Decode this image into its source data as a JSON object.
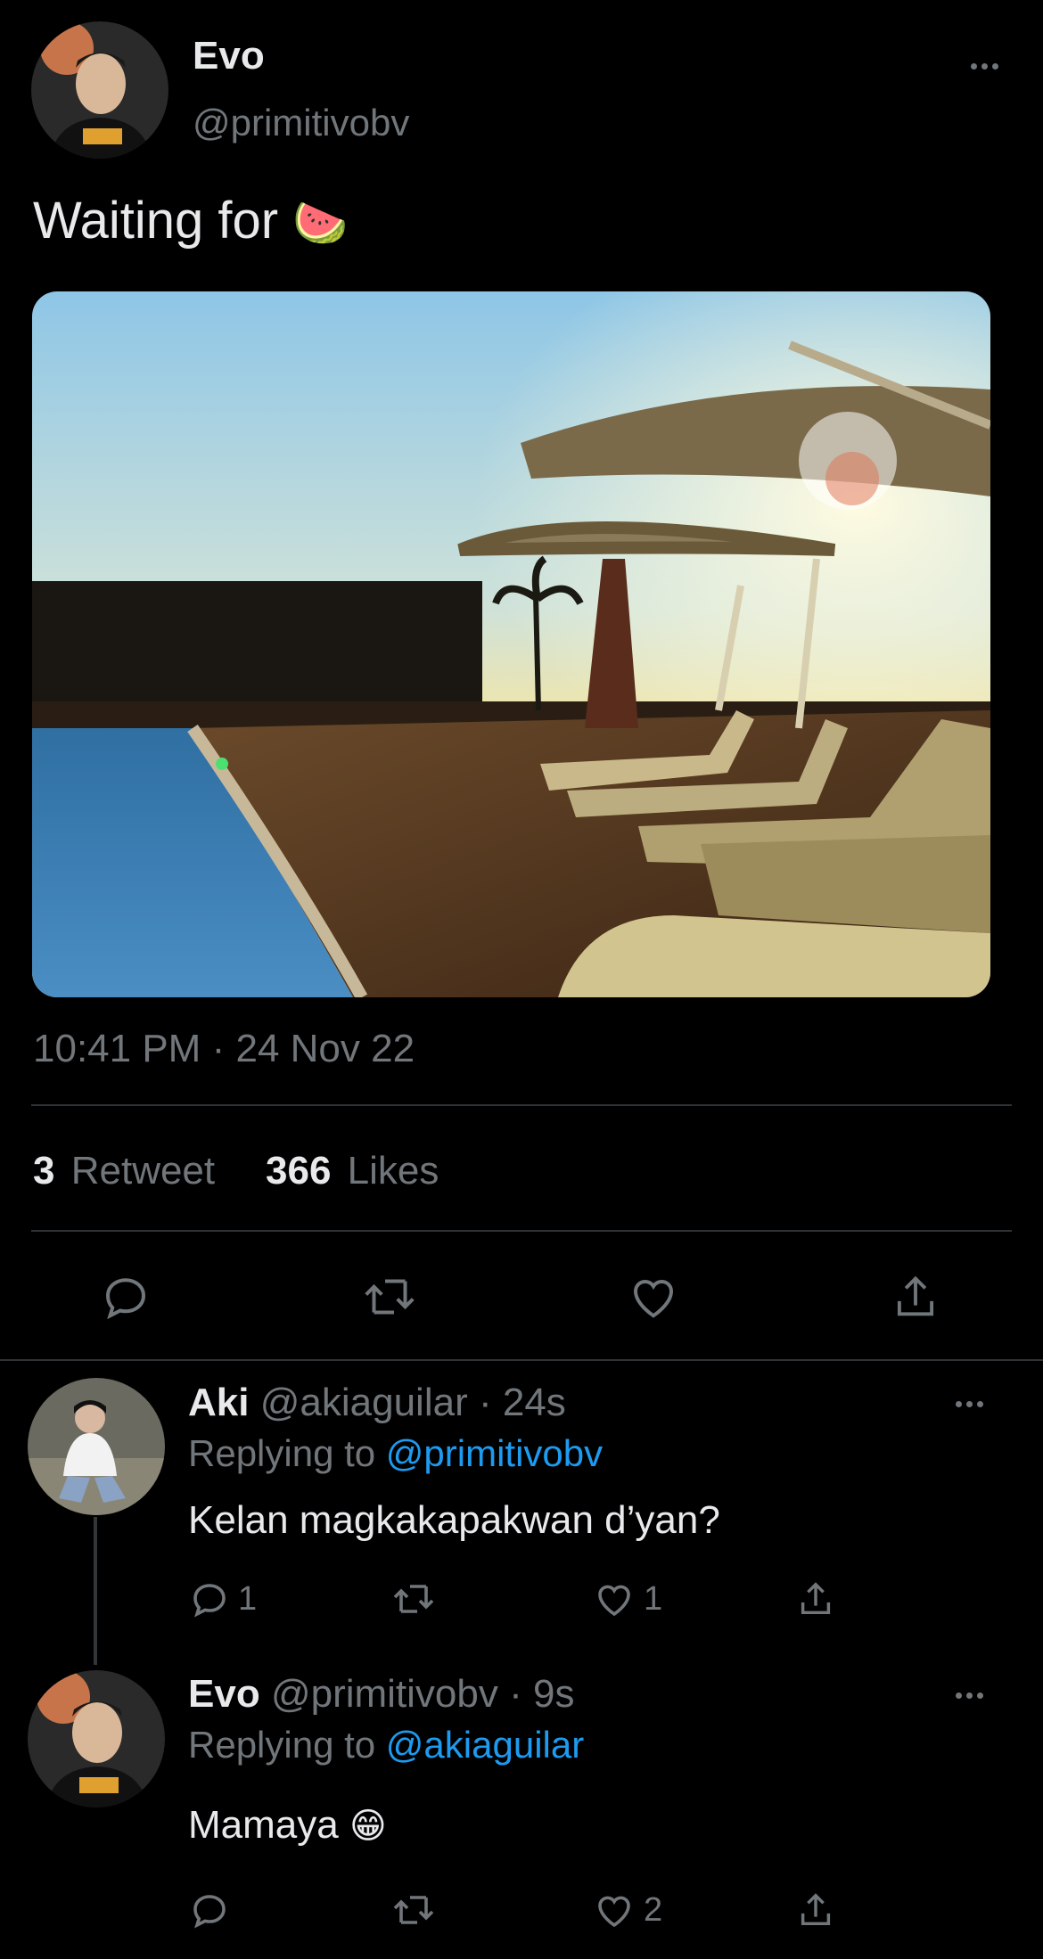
{
  "main_tweet": {
    "name": "Evo",
    "handle": "@primitivobv",
    "text": "Waiting for",
    "emoji": "🍉",
    "time": "10:41 PM",
    "date": "24 Nov 22",
    "retweets_count": "3",
    "retweets_label": "Retweet",
    "likes_count": "366",
    "likes_label": "Likes"
  },
  "replies": [
    {
      "name": "Aki",
      "handle": "@akiaguilar",
      "time": "24s",
      "replying_label": "Replying to",
      "replying_to": "@primitivobv",
      "text": "Kelan magkakapakwan d’yan?",
      "reply_count": "1",
      "like_count": "1"
    },
    {
      "name": "Evo",
      "handle": "@primitivobv",
      "time": "9s",
      "replying_label": "Replying to",
      "replying_to": "@akiaguilar",
      "text": "Mamaya",
      "emoji": "😁",
      "like_count": "2"
    }
  ],
  "colors": {
    "background": "#000000",
    "text": "#e7e9ea",
    "muted": "#71767b",
    "link": "#1d9bf0",
    "divider": "#2f3336"
  },
  "icons": [
    "more-icon",
    "reply-icon",
    "retweet-icon",
    "like-icon",
    "share-icon"
  ]
}
